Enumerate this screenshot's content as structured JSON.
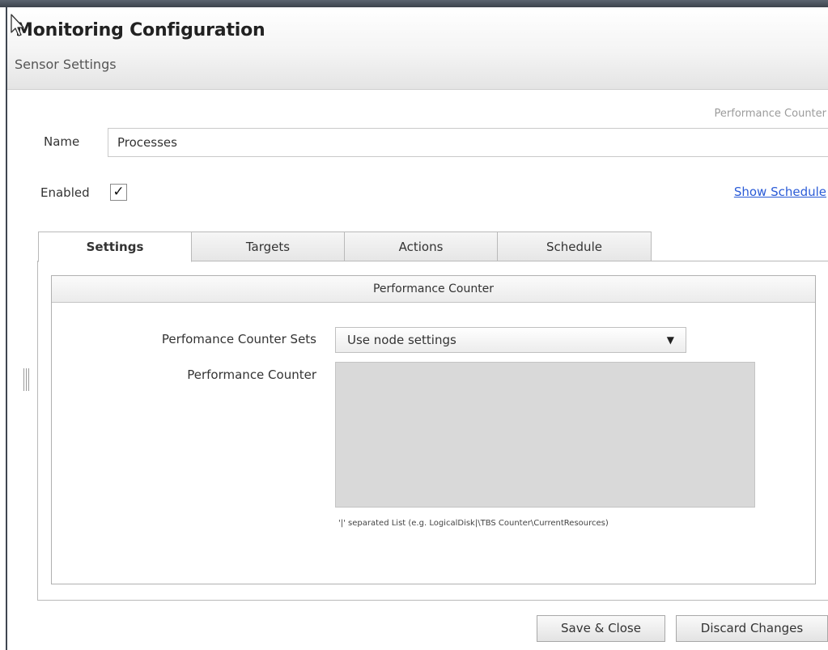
{
  "header": {
    "title": "Monitoring Configuration",
    "subtitle": "Sensor Settings"
  },
  "sensor": {
    "type_label": "Performance Counter",
    "name_label": "Name",
    "name_value": "Processes",
    "enabled_label": "Enabled",
    "enabled_checked": true,
    "enabled_mark": "✓",
    "show_schedule_link": "Show Schedule"
  },
  "tabs": [
    {
      "label": "Settings",
      "active": true
    },
    {
      "label": "Targets",
      "active": false
    },
    {
      "label": "Actions",
      "active": false
    },
    {
      "label": "Schedule",
      "active": false
    }
  ],
  "settings_panel": {
    "group_title": "Performance Counter",
    "counter_sets_label": "Perfomance Counter Sets",
    "counter_sets_value": "Use node settings",
    "counter_sets_arrow": "▼",
    "counter_label": "Performance Counter",
    "counter_value": "",
    "hint": "'|' separated List (e.g. LogicalDisk|\\TBS Counter\\CurrentResources)"
  },
  "buttons": {
    "save_close": "Save & Close",
    "discard": "Discard Changes"
  },
  "colors": {
    "link": "#2a5bd7",
    "topbar": "#3c434c",
    "textarea_bg": "#d9d9d9"
  },
  "icons": {
    "cursor": "mouse-pointer-icon",
    "splitter": "splitter-grip-icon"
  }
}
